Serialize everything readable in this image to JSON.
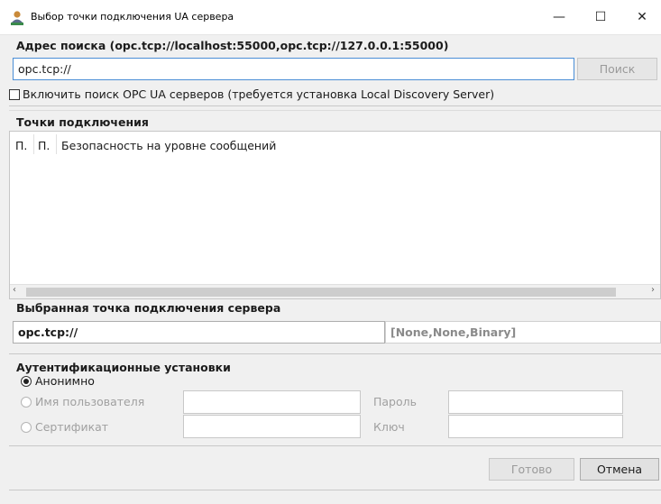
{
  "window": {
    "title": "Выбор точки подключения UA сервера",
    "icon": "user-network-icon",
    "minimize_glyph": "—",
    "maximize_glyph": "☐",
    "close_glyph": "✕"
  },
  "search": {
    "label": "Адрес поиска (opc.tcp://localhost:55000,opc.tcp://127.0.0.1:55000)",
    "value": "opc.tcp://",
    "button_label": "Поиск",
    "discovery_checkbox_label": "Включить поиск OPC UA серверов (требуется установка Local Discovery Server)",
    "discovery_checked": false
  },
  "endpoints": {
    "label": "Точки подключения",
    "columns": [
      "П.",
      "П.",
      "Безопасность на уровне сообщений"
    ]
  },
  "selected": {
    "label": "Выбранная точка подключения сервера",
    "value": "opc.tcp://",
    "security_info": "[None,None,Binary]"
  },
  "auth": {
    "label": "Аутентификационные установки",
    "anonymous_label": "Анонимно",
    "anonymous_selected": true,
    "username_label": "Имя пользователя",
    "password_label": "Пароль",
    "certificate_label": "Сертификат",
    "key_label": "Ключ"
  },
  "footer": {
    "done_label": "Готово",
    "cancel_label": "Отмена"
  },
  "colors": {
    "focus_border": "#4a8ed6",
    "panel_bg": "#f0f0f0",
    "disabled_text": "#9a9a9a"
  }
}
